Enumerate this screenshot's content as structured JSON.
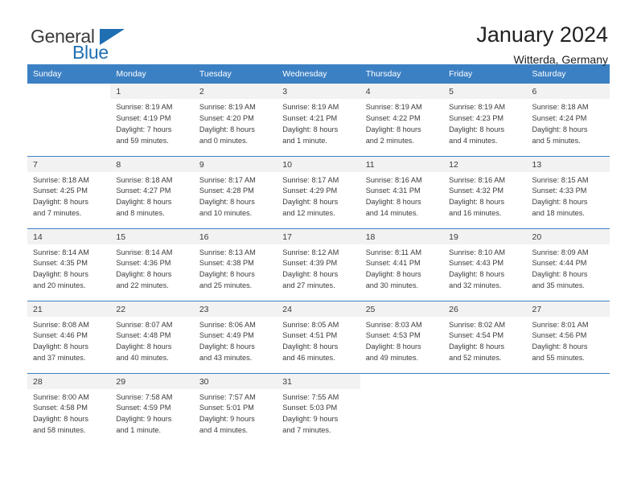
{
  "brand": {
    "name_dark": "General",
    "name_blue": "Blue"
  },
  "header": {
    "title": "January 2024",
    "subtitle": "Witterda, Germany"
  },
  "colors": {
    "header_blue": "#3c80c4",
    "brand_blue": "#1f6fb2",
    "daynum_bg": "#f2f2f2",
    "text": "#3b3b3b"
  },
  "weekdays": [
    "Sunday",
    "Monday",
    "Tuesday",
    "Wednesday",
    "Thursday",
    "Friday",
    "Saturday"
  ],
  "labels": {
    "sunrise": "Sunrise:",
    "sunset": "Sunset:",
    "daylight": "Daylight:"
  },
  "weeks": [
    [
      {
        "day": "",
        "sunrise": "",
        "sunset": "",
        "daylight1": "",
        "daylight2": ""
      },
      {
        "day": "1",
        "sunrise": "Sunrise: 8:19 AM",
        "sunset": "Sunset: 4:19 PM",
        "daylight1": "Daylight: 7 hours",
        "daylight2": "and 59 minutes."
      },
      {
        "day": "2",
        "sunrise": "Sunrise: 8:19 AM",
        "sunset": "Sunset: 4:20 PM",
        "daylight1": "Daylight: 8 hours",
        "daylight2": "and 0 minutes."
      },
      {
        "day": "3",
        "sunrise": "Sunrise: 8:19 AM",
        "sunset": "Sunset: 4:21 PM",
        "daylight1": "Daylight: 8 hours",
        "daylight2": "and 1 minute."
      },
      {
        "day": "4",
        "sunrise": "Sunrise: 8:19 AM",
        "sunset": "Sunset: 4:22 PM",
        "daylight1": "Daylight: 8 hours",
        "daylight2": "and 2 minutes."
      },
      {
        "day": "5",
        "sunrise": "Sunrise: 8:19 AM",
        "sunset": "Sunset: 4:23 PM",
        "daylight1": "Daylight: 8 hours",
        "daylight2": "and 4 minutes."
      },
      {
        "day": "6",
        "sunrise": "Sunrise: 8:18 AM",
        "sunset": "Sunset: 4:24 PM",
        "daylight1": "Daylight: 8 hours",
        "daylight2": "and 5 minutes."
      }
    ],
    [
      {
        "day": "7",
        "sunrise": "Sunrise: 8:18 AM",
        "sunset": "Sunset: 4:25 PM",
        "daylight1": "Daylight: 8 hours",
        "daylight2": "and 7 minutes."
      },
      {
        "day": "8",
        "sunrise": "Sunrise: 8:18 AM",
        "sunset": "Sunset: 4:27 PM",
        "daylight1": "Daylight: 8 hours",
        "daylight2": "and 8 minutes."
      },
      {
        "day": "9",
        "sunrise": "Sunrise: 8:17 AM",
        "sunset": "Sunset: 4:28 PM",
        "daylight1": "Daylight: 8 hours",
        "daylight2": "and 10 minutes."
      },
      {
        "day": "10",
        "sunrise": "Sunrise: 8:17 AM",
        "sunset": "Sunset: 4:29 PM",
        "daylight1": "Daylight: 8 hours",
        "daylight2": "and 12 minutes."
      },
      {
        "day": "11",
        "sunrise": "Sunrise: 8:16 AM",
        "sunset": "Sunset: 4:31 PM",
        "daylight1": "Daylight: 8 hours",
        "daylight2": "and 14 minutes."
      },
      {
        "day": "12",
        "sunrise": "Sunrise: 8:16 AM",
        "sunset": "Sunset: 4:32 PM",
        "daylight1": "Daylight: 8 hours",
        "daylight2": "and 16 minutes."
      },
      {
        "day": "13",
        "sunrise": "Sunrise: 8:15 AM",
        "sunset": "Sunset: 4:33 PM",
        "daylight1": "Daylight: 8 hours",
        "daylight2": "and 18 minutes."
      }
    ],
    [
      {
        "day": "14",
        "sunrise": "Sunrise: 8:14 AM",
        "sunset": "Sunset: 4:35 PM",
        "daylight1": "Daylight: 8 hours",
        "daylight2": "and 20 minutes."
      },
      {
        "day": "15",
        "sunrise": "Sunrise: 8:14 AM",
        "sunset": "Sunset: 4:36 PM",
        "daylight1": "Daylight: 8 hours",
        "daylight2": "and 22 minutes."
      },
      {
        "day": "16",
        "sunrise": "Sunrise: 8:13 AM",
        "sunset": "Sunset: 4:38 PM",
        "daylight1": "Daylight: 8 hours",
        "daylight2": "and 25 minutes."
      },
      {
        "day": "17",
        "sunrise": "Sunrise: 8:12 AM",
        "sunset": "Sunset: 4:39 PM",
        "daylight1": "Daylight: 8 hours",
        "daylight2": "and 27 minutes."
      },
      {
        "day": "18",
        "sunrise": "Sunrise: 8:11 AM",
        "sunset": "Sunset: 4:41 PM",
        "daylight1": "Daylight: 8 hours",
        "daylight2": "and 30 minutes."
      },
      {
        "day": "19",
        "sunrise": "Sunrise: 8:10 AM",
        "sunset": "Sunset: 4:43 PM",
        "daylight1": "Daylight: 8 hours",
        "daylight2": "and 32 minutes."
      },
      {
        "day": "20",
        "sunrise": "Sunrise: 8:09 AM",
        "sunset": "Sunset: 4:44 PM",
        "daylight1": "Daylight: 8 hours",
        "daylight2": "and 35 minutes."
      }
    ],
    [
      {
        "day": "21",
        "sunrise": "Sunrise: 8:08 AM",
        "sunset": "Sunset: 4:46 PM",
        "daylight1": "Daylight: 8 hours",
        "daylight2": "and 37 minutes."
      },
      {
        "day": "22",
        "sunrise": "Sunrise: 8:07 AM",
        "sunset": "Sunset: 4:48 PM",
        "daylight1": "Daylight: 8 hours",
        "daylight2": "and 40 minutes."
      },
      {
        "day": "23",
        "sunrise": "Sunrise: 8:06 AM",
        "sunset": "Sunset: 4:49 PM",
        "daylight1": "Daylight: 8 hours",
        "daylight2": "and 43 minutes."
      },
      {
        "day": "24",
        "sunrise": "Sunrise: 8:05 AM",
        "sunset": "Sunset: 4:51 PM",
        "daylight1": "Daylight: 8 hours",
        "daylight2": "and 46 minutes."
      },
      {
        "day": "25",
        "sunrise": "Sunrise: 8:03 AM",
        "sunset": "Sunset: 4:53 PM",
        "daylight1": "Daylight: 8 hours",
        "daylight2": "and 49 minutes."
      },
      {
        "day": "26",
        "sunrise": "Sunrise: 8:02 AM",
        "sunset": "Sunset: 4:54 PM",
        "daylight1": "Daylight: 8 hours",
        "daylight2": "and 52 minutes."
      },
      {
        "day": "27",
        "sunrise": "Sunrise: 8:01 AM",
        "sunset": "Sunset: 4:56 PM",
        "daylight1": "Daylight: 8 hours",
        "daylight2": "and 55 minutes."
      }
    ],
    [
      {
        "day": "28",
        "sunrise": "Sunrise: 8:00 AM",
        "sunset": "Sunset: 4:58 PM",
        "daylight1": "Daylight: 8 hours",
        "daylight2": "and 58 minutes."
      },
      {
        "day": "29",
        "sunrise": "Sunrise: 7:58 AM",
        "sunset": "Sunset: 4:59 PM",
        "daylight1": "Daylight: 9 hours",
        "daylight2": "and 1 minute."
      },
      {
        "day": "30",
        "sunrise": "Sunrise: 7:57 AM",
        "sunset": "Sunset: 5:01 PM",
        "daylight1": "Daylight: 9 hours",
        "daylight2": "and 4 minutes."
      },
      {
        "day": "31",
        "sunrise": "Sunrise: 7:55 AM",
        "sunset": "Sunset: 5:03 PM",
        "daylight1": "Daylight: 9 hours",
        "daylight2": "and 7 minutes."
      },
      {
        "day": "",
        "sunrise": "",
        "sunset": "",
        "daylight1": "",
        "daylight2": ""
      },
      {
        "day": "",
        "sunrise": "",
        "sunset": "",
        "daylight1": "",
        "daylight2": ""
      },
      {
        "day": "",
        "sunrise": "",
        "sunset": "",
        "daylight1": "",
        "daylight2": ""
      }
    ]
  ]
}
